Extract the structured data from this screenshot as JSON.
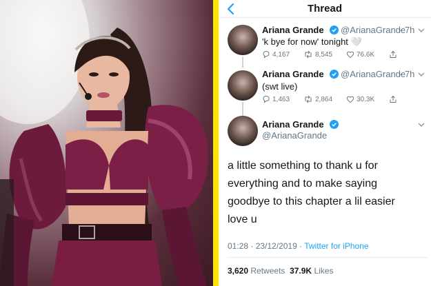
{
  "header": {
    "title": "Thread"
  },
  "tweets": [
    {
      "name": "Ariana Grande",
      "handle": "@ArianaGrande",
      "time": "· 7h",
      "text": "'k bye for now' tonight 🤍",
      "replies": "4,167",
      "retweets": "8,545",
      "likes": "76.6K"
    },
    {
      "name": "Ariana Grande",
      "handle": "@ArianaGrande",
      "time": "· 7h",
      "text": "(swt live)",
      "replies": "1,463",
      "retweets": "2,864",
      "likes": "30.3K"
    }
  ],
  "main_tweet": {
    "name": "Ariana Grande",
    "handle": "@ArianaGrande",
    "lines": [
      "a little something to thank u for",
      "everything and to make saying",
      "goodbye to this chapter a lil easier",
      "love u"
    ],
    "timestamp": "01:28 · 23/12/2019 · ",
    "source": "Twitter for iPhone",
    "retweets_count": "3,620",
    "retweets_label": "Retweets",
    "likes_count": "37.9K",
    "likes_label": "Likes"
  },
  "colors": {
    "accent": "#1da1f2",
    "divider": "#ffe600",
    "muted": "#657786"
  }
}
